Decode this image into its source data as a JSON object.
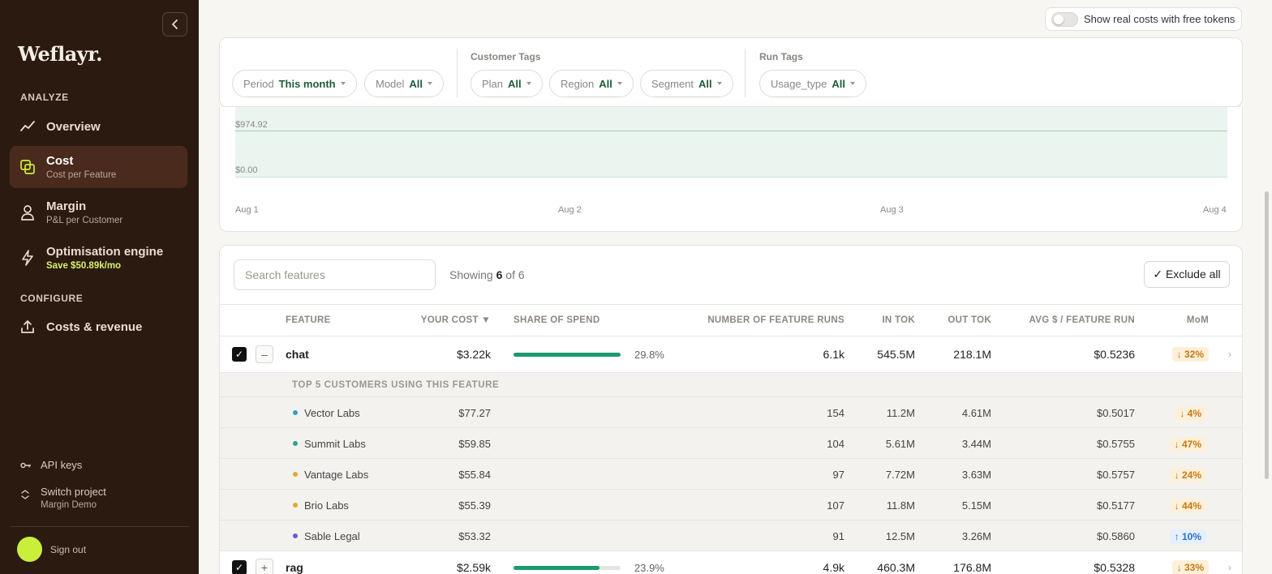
{
  "sidebar": {
    "logo": "Weflayr.",
    "section_analyze": "ANALYZE",
    "section_configure": "CONFIGURE",
    "nav": [
      {
        "label": "Overview",
        "sub": ""
      },
      {
        "label": "Cost",
        "sub": "Cost per Feature"
      },
      {
        "label": "Margin",
        "sub": "P&L per Customer"
      },
      {
        "label": "Optimisation engine",
        "sub": "Save $50.89k/mo"
      },
      {
        "label": "Costs & revenue",
        "sub": ""
      }
    ],
    "api_keys": "API keys",
    "switch_project": "Switch project",
    "project_name": "Margin Demo",
    "sign_out": "Sign out"
  },
  "toggle": {
    "label": "Show real costs with free tokens",
    "on": false
  },
  "filters": {
    "customer_tags_label": "Customer Tags",
    "run_tags_label": "Run Tags",
    "period": {
      "key": "Period",
      "value": "This month"
    },
    "model": {
      "key": "Model",
      "value": "All"
    },
    "plan": {
      "key": "Plan",
      "value": "All"
    },
    "region": {
      "key": "Region",
      "value": "All"
    },
    "segment": {
      "key": "Segment",
      "value": "All"
    },
    "usage_type": {
      "key": "Usage_type",
      "value": "All"
    }
  },
  "chart": {
    "y_top": "$974.92",
    "y_bottom": "$0.00",
    "x_labels": [
      "Aug 1",
      "Aug 2",
      "Aug 3",
      "Aug 4"
    ]
  },
  "table": {
    "search_placeholder": "Search features",
    "showing_prefix": "Showing",
    "showing_count": "6",
    "showing_suffix": "of 6",
    "exclude_all": "✓ Exclude all",
    "headers": {
      "feature": "FEATURE",
      "your_cost": "YOUR COST ▼",
      "share": "SHARE OF SPEND",
      "runs": "NUMBER OF FEATURE RUNS",
      "in_tok": "IN TOK",
      "out_tok": "OUT TOK",
      "avg": "AVG $ / FEATURE RUN",
      "mom": "MoM"
    },
    "top5_label": "TOP 5 CUSTOMERS USING THIS FEATURE",
    "rows": [
      {
        "name": "chat",
        "cost": "$3.22k",
        "share_pct": "29.8%",
        "share_fill": 0.298,
        "runs": "6.1k",
        "in_tok": "545.5M",
        "out_tok": "218.1M",
        "avg": "$0.5236",
        "mom": "↓ 32%",
        "expanded": true
      },
      {
        "name": "rag",
        "cost": "$2.59k",
        "share_pct": "23.9%",
        "share_fill": 0.239,
        "runs": "4.9k",
        "in_tok": "460.3M",
        "out_tok": "176.8M",
        "avg": "$0.5328",
        "mom": "↓ 33%",
        "expanded": false
      }
    ],
    "customers": [
      {
        "name": "Vector Labs",
        "color": "#3b9bc4",
        "cost": "$77.27",
        "runs": "154",
        "in_tok": "11.2M",
        "out_tok": "4.61M",
        "avg": "$0.5017",
        "mom": "↓ 4%",
        "dir": "down"
      },
      {
        "name": "Summit Labs",
        "color": "#2aa58a",
        "cost": "$59.85",
        "runs": "104",
        "in_tok": "5.61M",
        "out_tok": "3.44M",
        "avg": "$0.5755",
        "mom": "↓ 47%",
        "dir": "down"
      },
      {
        "name": "Vantage Labs",
        "color": "#e6a82a",
        "cost": "$55.84",
        "runs": "97",
        "in_tok": "7.72M",
        "out_tok": "3.63M",
        "avg": "$0.5757",
        "mom": "↓ 24%",
        "dir": "down"
      },
      {
        "name": "Brio Labs",
        "color": "#e6a82a",
        "cost": "$55.39",
        "runs": "107",
        "in_tok": "11.8M",
        "out_tok": "5.15M",
        "avg": "$0.5177",
        "mom": "↓ 44%",
        "dir": "down"
      },
      {
        "name": "Sable Legal",
        "color": "#6a5bd3",
        "cost": "$53.32",
        "runs": "91",
        "in_tok": "12.5M",
        "out_tok": "3.26M",
        "avg": "$0.5860",
        "mom": "↑ 10%",
        "dir": "up"
      }
    ]
  }
}
